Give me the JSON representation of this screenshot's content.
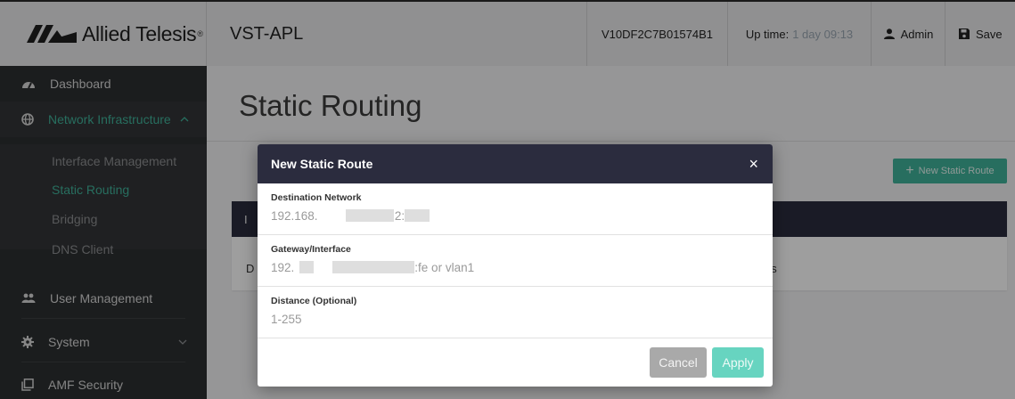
{
  "topbar": {
    "logo_text": "Allied Telesis",
    "logo_tm": "®",
    "device_name": "VST-APL",
    "serial": "V10DF2C7B01574B1",
    "uptime_label": "Up time:",
    "uptime_value": "1 day 09:13",
    "admin_label": "Admin",
    "save_label": "Save"
  },
  "sidebar": {
    "dashboard": "Dashboard",
    "network_infrastructure": "Network Infrastructure",
    "sub_items": [
      "Interface Management",
      "Static Routing",
      "Bridging",
      "DNS Client"
    ],
    "user_management": "User Management",
    "system": "System",
    "amf_security": "AMF Security"
  },
  "main": {
    "page_title": "Static Routing",
    "new_route_button": "New Static Route",
    "new_route_plus": "+",
    "card_head_partial": "I",
    "card_row_left": "D",
    "card_row_right": "us"
  },
  "modal": {
    "title": "New Static Route",
    "close": "×",
    "fields": [
      {
        "label": "Destination Network",
        "placeholder": "192.168.                      :2::/48"
      },
      {
        "label": "Gateway/Interface",
        "placeholder": "192.                                   ::fe or vlan1"
      },
      {
        "label": "Distance (Optional)",
        "placeholder": "1-255"
      }
    ],
    "cancel": "Cancel",
    "apply": "Apply"
  },
  "colors": {
    "accent": "#40b29a",
    "header_dark": "#2b2c3e",
    "sidebar_bg": "#2d2f31"
  },
  "icons": {
    "logo": "allied-telesis-logo",
    "dashboard": "speedometer-icon",
    "network": "globe-icon",
    "users": "users-icon",
    "system": "gear-icon",
    "amf": "copy-icon",
    "admin": "person-icon",
    "save": "floppy-icon"
  }
}
